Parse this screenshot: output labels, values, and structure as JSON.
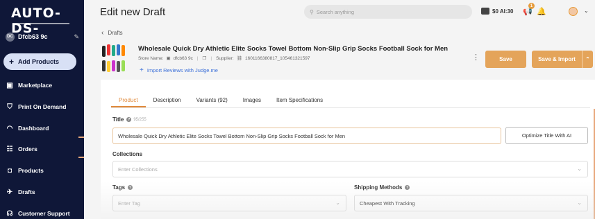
{
  "app": {
    "logo": "AUTO-DS-",
    "page_title": "Edit new Draft"
  },
  "sidebar": {
    "store": {
      "initials": "DC",
      "name": "Dfcb63 9c"
    },
    "add_button": "Add Products",
    "items": [
      {
        "label": "Marketplace",
        "icon": "store-icon"
      },
      {
        "label": "Print On Demand",
        "icon": "shirt-icon"
      },
      {
        "label": "Dashboard",
        "icon": "gauge-icon"
      },
      {
        "label": "Orders",
        "icon": "orders-icon"
      },
      {
        "label": "Products",
        "icon": "box-icon"
      },
      {
        "label": "Drafts",
        "icon": "drafts-icon"
      },
      {
        "label": "Customer Support",
        "icon": "headset-icon"
      }
    ]
  },
  "header": {
    "search_placeholder": "Search anything",
    "credits": "$0  AI:30",
    "notifications_count": "1"
  },
  "breadcrumb": {
    "label": "Drafts"
  },
  "product": {
    "title": "Wholesale Quick Dry Athletic Elite Socks Towel Bottom Non-Slip Grip Socks Football Sock for Men",
    "store_label": "Store Name:",
    "store_name": "dfcb63 9c",
    "supplier_label": "Supplier:",
    "supplier_id": "1601166380817_105461321597",
    "import_reviews": "Import Reviews with Judge.me"
  },
  "actions": {
    "save": "Save",
    "save_import": "Save & Import"
  },
  "tabs": [
    {
      "label": "Product",
      "active": true
    },
    {
      "label": "Description",
      "active": false
    },
    {
      "label": "Variants (92)",
      "active": false
    },
    {
      "label": "Images",
      "active": false
    },
    {
      "label": "Item Specifications",
      "active": false
    }
  ],
  "form": {
    "title_label": "Title",
    "title_count": "95/255",
    "title_value": "Wholesale Quick Dry Athletic Elite Socks Towel Bottom Non-Slip Grip Socks Football Sock for Men",
    "optimize_button": "Optimize Title With AI",
    "collections_label": "Collections",
    "collections_placeholder": "Enter Collections",
    "tags_label": "Tags",
    "tags_placeholder": "Enter Tag",
    "shipping_label": "Shipping Methods",
    "shipping_value": "Cheapest With Tracking"
  },
  "colors": {
    "sidebar": "#0f1738",
    "accent": "#e4a45a",
    "link": "#3b6fd8"
  }
}
